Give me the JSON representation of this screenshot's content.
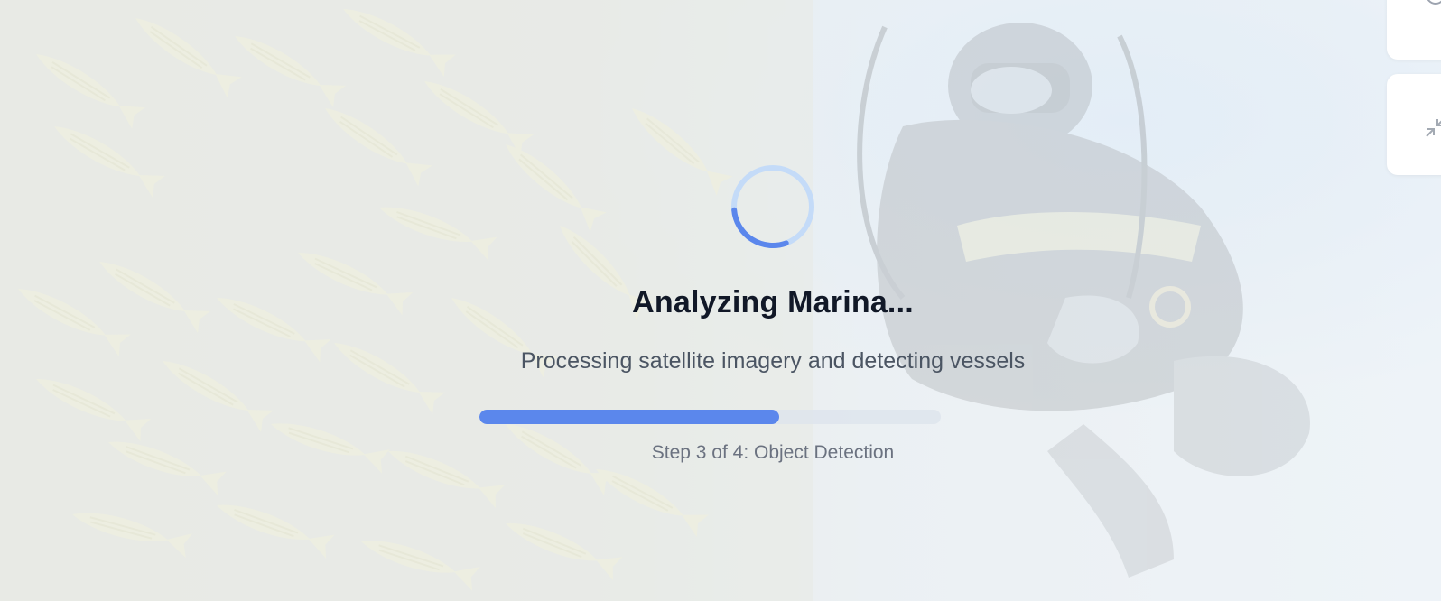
{
  "loading": {
    "title": "Analyzing Marina...",
    "subtitle": "Processing satellite imagery and detecting vessels",
    "progress_fraction": 0.65,
    "step_label": "Step 3 of 4: Object Detection",
    "spinner_icon": "loading-spinner-icon"
  },
  "colors": {
    "accent": "#5b87ec",
    "spinner_track": "#c4dbf8",
    "title": "#111827",
    "subtitle": "#4b5563",
    "step_label": "#6b7280"
  },
  "map_controls": [
    {
      "icon": "zoom-in-icon"
    },
    {
      "icon": "collapse-icon"
    }
  ]
}
